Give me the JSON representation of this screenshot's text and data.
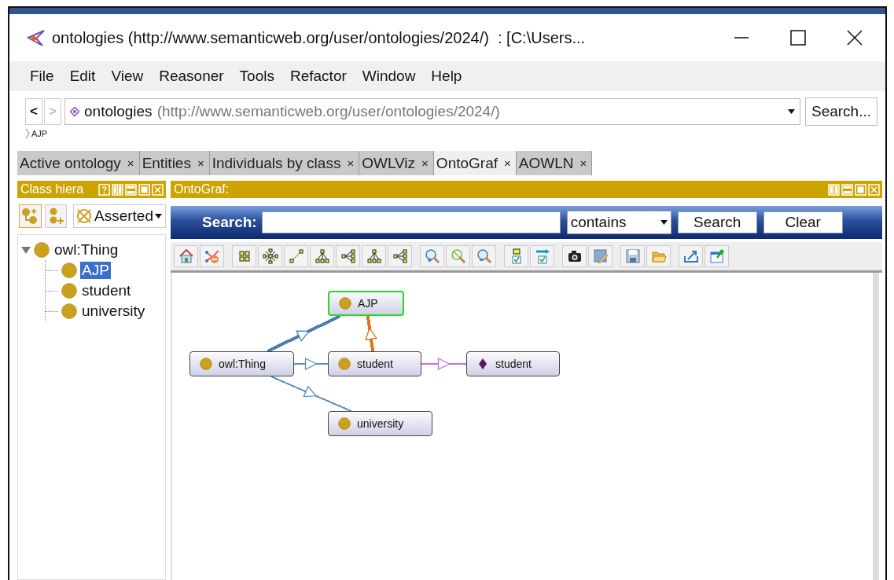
{
  "window": {
    "title": "ontologies (http://www.semanticweb.org/user/ontologies/2024/)  : [C:\\Users..."
  },
  "menu": [
    "File",
    "Edit",
    "View",
    "Reasoner",
    "Tools",
    "Refactor",
    "Window",
    "Help"
  ],
  "address_bar": {
    "back": "<",
    "forward": ">",
    "forward_disabled": true,
    "ontology_name": "ontologies",
    "ontology_iri": "(http://www.semanticweb.org/user/ontologies/2024/)",
    "search_button": "Search..."
  },
  "breadcrumb": "AJP",
  "tabs": [
    {
      "label": "Active ontology",
      "close": "×",
      "selected": false
    },
    {
      "label": "Entities",
      "close": "×",
      "selected": false
    },
    {
      "label": "Individuals by class",
      "close": "×",
      "selected": false
    },
    {
      "label": "OWLViz",
      "close": "×",
      "selected": false
    },
    {
      "label": "OntoGraf",
      "close": "×",
      "selected": true
    },
    {
      "label": "AOWLN",
      "close": "×",
      "selected": false
    }
  ],
  "class_panel": {
    "title": "Class hiera",
    "mode": "Asserted",
    "tree": [
      {
        "label": "owl:Thing",
        "expanded": true,
        "selected": false,
        "children": [
          {
            "label": "AJP",
            "selected": true
          },
          {
            "label": "student",
            "selected": false
          },
          {
            "label": "university",
            "selected": false
          }
        ]
      }
    ]
  },
  "ontograf": {
    "title": "OntoGraf:",
    "search_label": "Search:",
    "match_mode": "contains",
    "search_button": "Search",
    "clear_button": "Clear",
    "nodes": [
      {
        "label": "AJP",
        "kind": "class",
        "selected": true
      },
      {
        "label": "owl:Thing",
        "kind": "class",
        "selected": false
      },
      {
        "label": "student",
        "kind": "class",
        "selected": false
      },
      {
        "label": "student",
        "kind": "individual",
        "selected": false
      },
      {
        "label": "university",
        "kind": "class",
        "selected": false
      }
    ],
    "edges": [
      {
        "color": "#4a7fb5",
        "emphasized": true
      },
      {
        "color": "#5a8fc0",
        "emphasized": false
      },
      {
        "color": "#5a8fc0",
        "emphasized": false
      },
      {
        "color": "#e0701e",
        "emphasized": true
      },
      {
        "color": "#c770e0",
        "emphasized": false
      }
    ]
  }
}
